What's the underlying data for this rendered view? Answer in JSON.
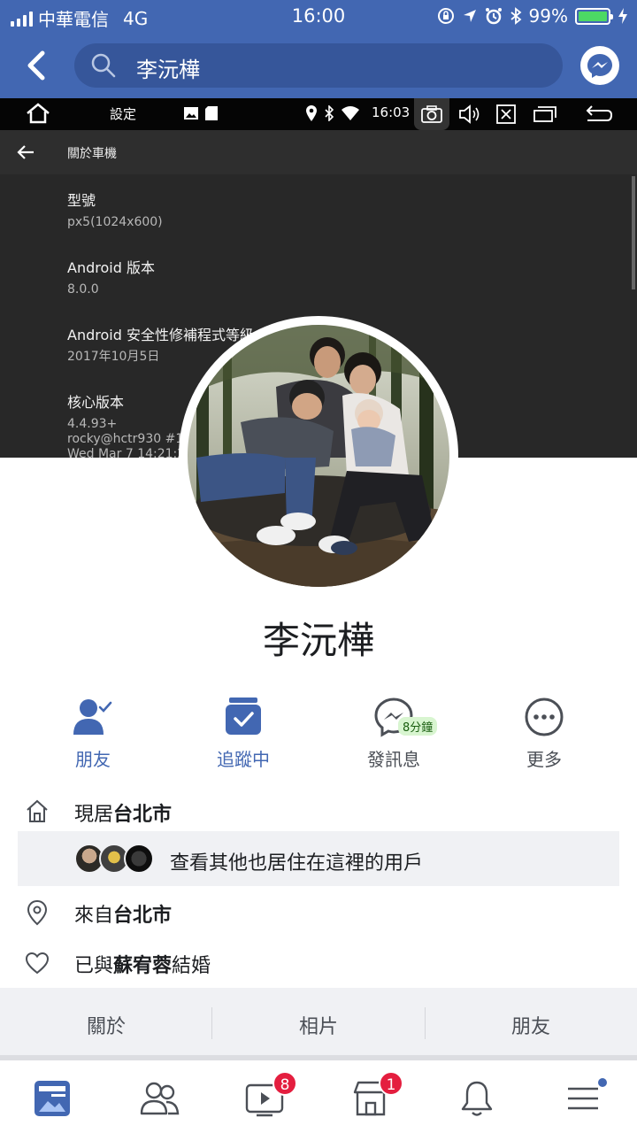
{
  "status_bar": {
    "carrier": "中華電信",
    "network": "4G",
    "time": "16:00",
    "battery": "99%",
    "battery_level": 0.99
  },
  "header": {
    "search_text": "李沅樺"
  },
  "cover": {
    "bar": {
      "settings": "設定",
      "time": "16:03"
    },
    "title": "關於車機",
    "items": [
      {
        "key": "型號",
        "value": "px5(1024x600)"
      },
      {
        "key": "Android 版本",
        "value": "8.0.0"
      },
      {
        "key": "Android 安全性修補程式等級",
        "value": "2017年10月5日"
      },
      {
        "key": "核心版本",
        "value": "4.4.93+\nrocky@hctr930 #14\nWed Mar 7 14:21:23"
      }
    ]
  },
  "profile": {
    "name": "李沅樺"
  },
  "actions": [
    {
      "label": "朋友",
      "icon": "friend-check-icon"
    },
    {
      "label": "追蹤中",
      "icon": "following-icon"
    },
    {
      "label": "發訊息",
      "icon": "messenger-icon",
      "badge": "8分鐘"
    },
    {
      "label": "更多",
      "icon": "more-icon"
    }
  ],
  "info": {
    "lives_prefix": "現居",
    "lives_city": "台北市",
    "others_text": "查看其他也居住在這裡的用戶",
    "from_prefix": "來自",
    "from_city": "台北市",
    "married_prefix": "已與",
    "married_name": "蘇宥蓉",
    "married_suffix": "結婚"
  },
  "tabs": [
    "關於",
    "相片",
    "朋友"
  ],
  "bottom_nav": {
    "watch_badge": "8",
    "marketplace_badge": "1"
  },
  "colors": {
    "brand": "#4267b2",
    "badge": "#e41e3f"
  }
}
